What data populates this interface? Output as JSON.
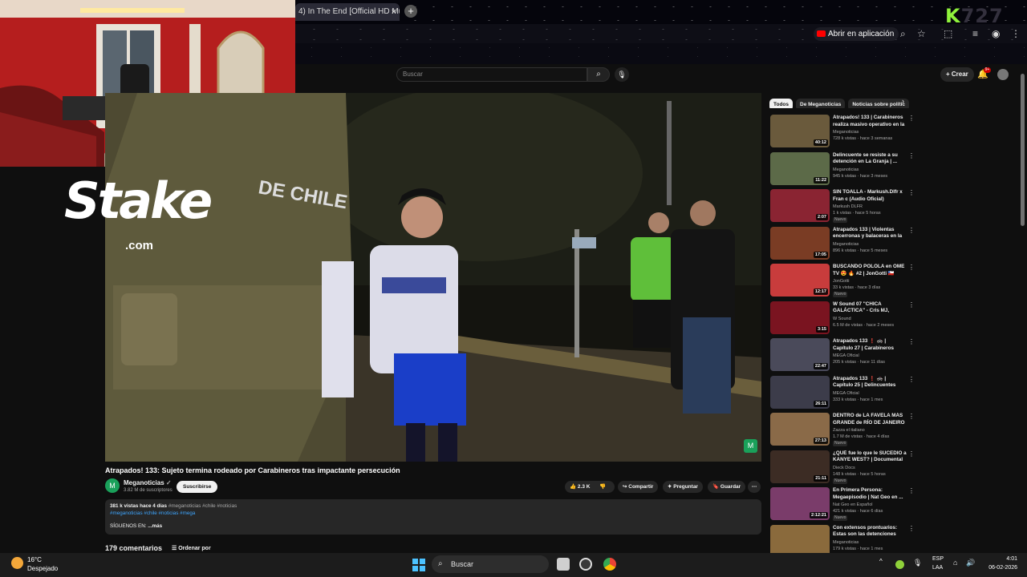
{
  "browser": {
    "tab_title": "4) In The End [Official HD Mu",
    "tab_close": "×",
    "new_tab": "+",
    "open_app": "Abrir en aplicación",
    "overlay_badge_k": "K",
    "overlay_badge_rest": "727"
  },
  "youtube": {
    "search_placeholder": "Buscar",
    "create": "+ Crear",
    "notifications_count": "9+"
  },
  "stake": {
    "word": "Stake",
    "domain": ".com"
  },
  "video": {
    "title": "Atrapados! 133: Sujeto termina rodeado por Carabineros tras impactante persecución",
    "channel": "Meganoticias",
    "subscribers": "3.82 M de suscriptores",
    "subscribe": "Suscribirse",
    "likes": "2.3 K",
    "share": "Compartir",
    "ask": "Preguntar",
    "save": "Guardar"
  },
  "description": {
    "stats": "381 k vistas  hace 4 días",
    "tags_line1": "#meganoticias #chile #noticias",
    "tags_line2": "#meganoticias #chile #noticias #mega",
    "follow": "SÍGUENOS EN:",
    "more": "...más"
  },
  "comments": {
    "count": "179 comentarios",
    "sort": "Ordenar por"
  },
  "rail": {
    "chips": [
      "Todos",
      "De Meganoticias",
      "Noticias sobre polític"
    ],
    "items": [
      {
        "title": "Atrapados! 133 | Carabineros realiza masivo operativo en la ...",
        "channel": "Meganoticias",
        "meta": "728 k vistas · hace 3 semanas",
        "duration": "40:12",
        "badge": "",
        "color": "#6a5a3c"
      },
      {
        "title": "Delincuente se resiste a su detención en La Granja | ...",
        "channel": "Meganoticias",
        "meta": "945 k vistas · hace 3 meses",
        "duration": "11:22",
        "badge": "",
        "color": "#5c6a48"
      },
      {
        "title": "SIN TOALLA - Markush.Dlfr x Fran c (Audio Oficial)",
        "channel": "Markush DLFR",
        "meta": "1 k vistas · hace 5 horas",
        "duration": "2:07",
        "badge": "Nuevo",
        "color": "#8a2432"
      },
      {
        "title": "Atrapados 133 | Violentas encerronas y balaceras en la ...",
        "channel": "Meganoticias",
        "meta": "896 k vistas · hace 5 meses",
        "duration": "17:05",
        "badge": "",
        "color": "#7a3c24"
      },
      {
        "title": "BUSCANDO POLOLA en OME TV 😍 🔥 #2 | JonGotti 🇨🇱",
        "channel": "JonGotti",
        "meta": "33 k vistas · hace 3 días",
        "duration": "12:17",
        "badge": "Nuevo",
        "color": "#c83c3c"
      },
      {
        "title": "W Sound 07 \"CHICA GALÁCTICA\" - Cris MJ, Westc...",
        "channel": "W Sound",
        "meta": "6.5 M de vistas · hace 2 meses",
        "duration": "3:15",
        "badge": "",
        "color": "#7a1420"
      },
      {
        "title": "Atrapados 133 ❗ 🚓 | Capítulo 27 | Carabineros realiza ...",
        "channel": "MEGA Oficial",
        "meta": "205 k vistas · hace 11 días",
        "duration": "22:47",
        "badge": "",
        "color": "#4a4a5a"
      },
      {
        "title": "Atrapados 133 ❗ 🚓 | Capítulo 25 | Delincuentes fueron ...",
        "channel": "MEGA Oficial",
        "meta": "333 k vistas · hace 1 mes",
        "duration": "26:11",
        "badge": "",
        "color": "#3c3c4a"
      },
      {
        "title": "DENTRO de LA FAVELA MÁS GRANDE de RÍO DE JANEIRO ...",
        "channel": "Zazza el italiano",
        "meta": "1.7 M de vistas · hace 4 días",
        "duration": "27:13",
        "badge": "Nuevo",
        "color": "#8a6a48"
      },
      {
        "title": "¿QUÉ fue lo que le SUCEDIÓ a KANYE WEST? | Documental",
        "channel": "Dieck Docs",
        "meta": "148 k vistas · hace 5 horas",
        "duration": "21:11",
        "badge": "Nuevo",
        "color": "#3c2c24"
      },
      {
        "title": "En Primera Persona: Megaepisodio | Nat Geo en ...",
        "channel": "Nat Geo en Español",
        "meta": "421 k vistas · hace 6 días",
        "duration": "2:12:21",
        "badge": "Nuevo",
        "color": "#7a3c6a"
      },
      {
        "title": "Con extensos prontuarios: Estas son las detenciones má...",
        "channel": "Meganoticias",
        "meta": "179 k vistas · hace 1 mes",
        "duration": "",
        "badge": "",
        "color": "#8a6a3c"
      }
    ]
  },
  "taskbar": {
    "temperature": "16°C",
    "condition": "Despejado",
    "search": "Buscar",
    "lang1": "ESP",
    "lang2": "LAA",
    "time": "4:01",
    "date": "06-02-2026"
  }
}
